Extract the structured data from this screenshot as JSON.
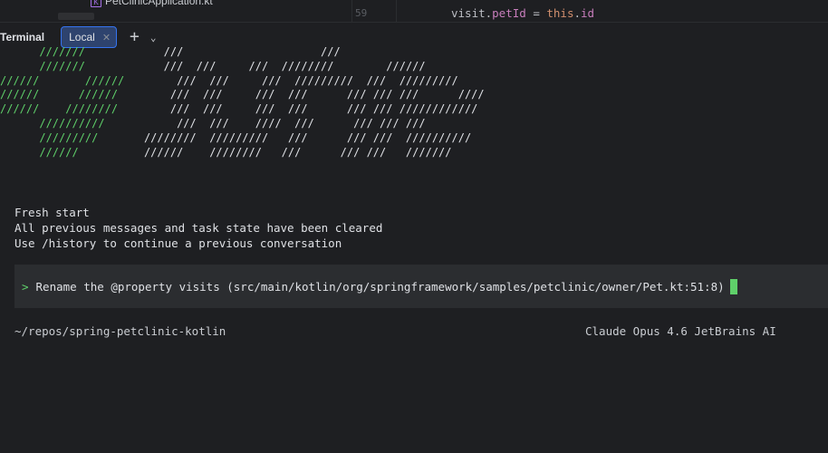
{
  "editor": {
    "tree_file": "PetClinicApplication.kt",
    "line_number": "59",
    "code_prev": "              ",
    "code_obj": "visit.",
    "code_prop": "petId",
    "code_eq": " = ",
    "code_kw": "this",
    "code_dot": ".",
    "code_id": "id"
  },
  "terminal": {
    "title": "Terminal",
    "tabs": [
      {
        "label": "Local",
        "active": true
      }
    ],
    "banner": [
      [
        [
          "g",
          "      /////// "
        ],
        [
          "w",
          "           ///                     ///"
        ]
      ],
      [
        [
          "g",
          "      /////// "
        ],
        [
          "w",
          "           ///  ///     ///  ////////        //////"
        ]
      ],
      [
        [
          "g",
          "//////       //////  "
        ],
        [
          "w",
          "      ///  ///     ///  /////////  ///  /////////"
        ]
      ],
      [
        [
          "g",
          "//////      ////// "
        ],
        [
          "w",
          "       ///  ///     ///  ///      /// /// ///      ////"
        ]
      ],
      [
        [
          "g",
          "//////    //////// "
        ],
        [
          "w",
          "       ///  ///     ///  ///      /// /// ////////////"
        ]
      ],
      [
        [
          "g",
          "      ////////// "
        ],
        [
          "w",
          "          ///  ///    ////  ///      /// /// ///"
        ]
      ],
      [
        [
          "g",
          "      ///////// "
        ],
        [
          "w",
          "      ////////  /////////   ///      /// ///  //////////"
        ]
      ],
      [
        [
          "g",
          "      ////// "
        ],
        [
          "w",
          "         //////    ////////   ///      /// ///   ///////"
        ]
      ]
    ],
    "messages": [
      "Fresh start",
      "All previous messages and task state have been cleared",
      "Use /history to continue a previous conversation"
    ],
    "prompt_marker": ">",
    "prompt_text": "Rename the @property visits (src/main/kotlin/org/springframework/samples/petclinic/owner/Pet.kt:51:8)",
    "cwd": "~/repos/spring-petclinic-kotlin",
    "model": "Claude Opus 4.6 JetBrains AI"
  },
  "colors": {
    "accent_green": "#5fd06a",
    "tab_active_bg": "#2e436e",
    "background": "#1e1f22"
  }
}
